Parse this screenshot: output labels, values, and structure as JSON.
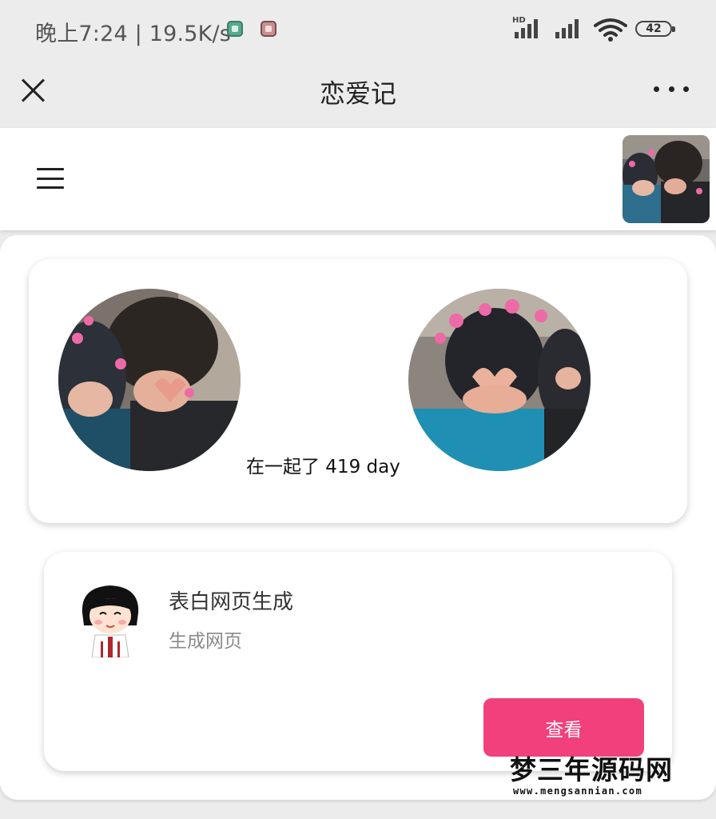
{
  "status_bar": {
    "time_speed": "晚上7:24 | 19.5K/s",
    "network_label": "HD",
    "battery": "42",
    "icons": [
      "app-notification-icon",
      "photo-notification-icon",
      "cell-signal-icon",
      "cell-signal-icon",
      "wifi-icon",
      "battery-icon"
    ]
  },
  "title_bar": {
    "title": "恋爱记",
    "icons": [
      "close-icon",
      "more-icon"
    ]
  },
  "header": {
    "icons": [
      "menu-icon"
    ]
  },
  "couple_card": {
    "together_text": "在一起了 419 day"
  },
  "feature_card": {
    "title": "表白网页生成",
    "subtitle": "生成网页",
    "button_label": "查看"
  },
  "watermark": {
    "name": "梦三年源码网",
    "url": "www.mengsannian.com"
  },
  "colors": {
    "accent": "#f1407b",
    "background": "#ececec",
    "card": "#ffffff"
  }
}
